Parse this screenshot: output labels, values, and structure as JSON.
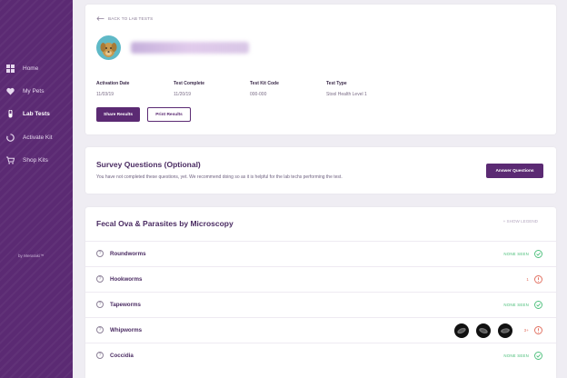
{
  "sidebar": {
    "items": [
      {
        "label": "Home",
        "icon": "grid-icon"
      },
      {
        "label": "My Pets",
        "icon": "heart-icon"
      },
      {
        "label": "Lab Tests",
        "icon": "test-tube-icon",
        "active": true
      },
      {
        "label": "Activate Kit",
        "icon": "activate-icon"
      },
      {
        "label": "Shop Kits",
        "icon": "cart-icon"
      }
    ],
    "powered_by": "by Meraraki™"
  },
  "header": {
    "back_label": "BACK TO LAB TESTS",
    "details": [
      {
        "label": "Activation Date",
        "value": "11/03/19"
      },
      {
        "label": "Test Complete",
        "value": "11/20/19"
      },
      {
        "label": "Test Kit Code",
        "value": "000-000"
      },
      {
        "label": "Test Type",
        "value": "Stool Health Level 1"
      }
    ],
    "share_label": "Share Results",
    "print_label": "Print Results"
  },
  "survey": {
    "title": "Survey Questions (Optional)",
    "text": "You have not completed these questions, yet. We recommend doing so as it is helpful for the lab techs performing the test.",
    "button_label": "Answer Questions"
  },
  "fecal": {
    "title": "Fecal Ova & Parasites by Microscopy",
    "legend_label": "+  SHOW LEGEND",
    "rows": [
      {
        "name": "Roundworms",
        "result": "NONE SEEN",
        "status": "ok"
      },
      {
        "name": "Hookworms",
        "result": "1",
        "status": "alert"
      },
      {
        "name": "Tapeworms",
        "result": "NONE SEEN",
        "status": "ok"
      },
      {
        "name": "Whipworms",
        "result": "3+",
        "status": "alert"
      },
      {
        "name": "Coccidia",
        "result": "NONE SEEN",
        "status": "ok"
      }
    ]
  },
  "colors": {
    "brand": "#5b2a73",
    "ok": "#4bbf7a",
    "alert": "#e06a5a"
  }
}
